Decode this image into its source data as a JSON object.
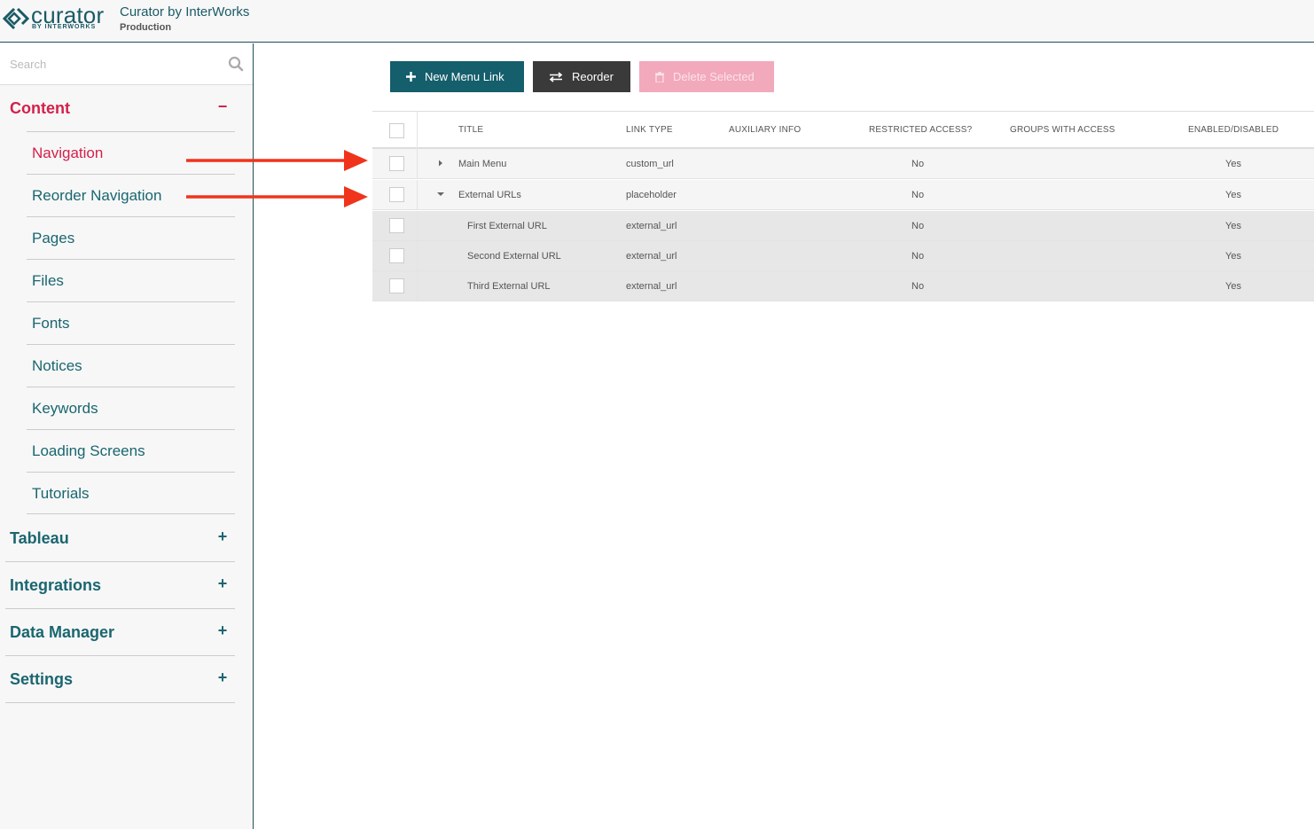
{
  "header": {
    "logo_word": "curator",
    "logo_sub": "BY INTERWORKS",
    "app_title": "Curator by InterWorks",
    "environment": "Production"
  },
  "search": {
    "placeholder": "Search"
  },
  "sidebar": {
    "content": {
      "title": "Content",
      "toggle": "−",
      "items": [
        {
          "label": "Navigation"
        },
        {
          "label": "Reorder Navigation"
        },
        {
          "label": "Pages"
        },
        {
          "label": "Files"
        },
        {
          "label": "Fonts"
        },
        {
          "label": "Notices"
        },
        {
          "label": "Keywords"
        },
        {
          "label": "Loading Screens"
        },
        {
          "label": "Tutorials"
        }
      ]
    },
    "sections": [
      {
        "title": "Tableau",
        "toggle": "+"
      },
      {
        "title": "Integrations",
        "toggle": "+"
      },
      {
        "title": "Data Manager",
        "toggle": "+"
      },
      {
        "title": "Settings",
        "toggle": "+"
      }
    ]
  },
  "toolbar": {
    "new_label": "New Menu Link",
    "reorder_label": "Reorder",
    "delete_label": "Delete Selected"
  },
  "table": {
    "columns": [
      "TITLE",
      "LINK TYPE",
      "AUXILIARY INFO",
      "RESTRICTED ACCESS?",
      "GROUPS WITH ACCESS",
      "ENABLED/DISABLED"
    ],
    "rows": [
      {
        "title": "Main Menu",
        "link_type": "custom_url",
        "aux": "",
        "restricted": "No",
        "groups": "",
        "enabled": "Yes"
      },
      {
        "title": "External URLs",
        "link_type": "placeholder",
        "aux": "",
        "restricted": "No",
        "groups": "",
        "enabled": "Yes"
      },
      {
        "title": "First External URL",
        "link_type": "external_url",
        "aux": "",
        "restricted": "No",
        "groups": "",
        "enabled": "Yes"
      },
      {
        "title": "Second External URL",
        "link_type": "external_url",
        "aux": "",
        "restricted": "No",
        "groups": "",
        "enabled": "Yes"
      },
      {
        "title": "Third External URL",
        "link_type": "external_url",
        "aux": "",
        "restricted": "No",
        "groups": "",
        "enabled": "Yes"
      }
    ]
  },
  "colors": {
    "brand_teal": "#155e6b",
    "active_red": "#d4204a",
    "annotation_arrow": "#f0341c"
  }
}
